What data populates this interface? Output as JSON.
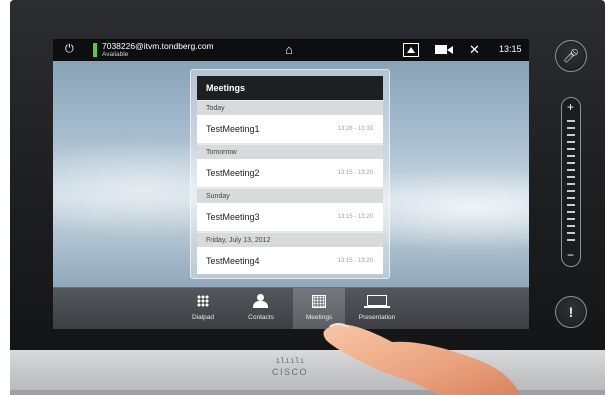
{
  "status_bar": {
    "user": "7038226@itvm.tondberg.com",
    "availability": "Available",
    "time": "13:15",
    "icons": [
      "power-icon",
      "home-icon",
      "selfview-icon",
      "camera-icon",
      "settings-tools-icon"
    ],
    "status_color": "#5fc83a"
  },
  "meetings_panel": {
    "title": "Meetings",
    "groups": [
      {
        "header": "Today",
        "meetings": [
          {
            "name": "TestMeeting1",
            "time": "13:28 - 13:33"
          }
        ]
      },
      {
        "header": "Tomorrow",
        "meetings": [
          {
            "name": "TestMeeting2",
            "time": "13:15 - 13:20"
          }
        ]
      },
      {
        "header": "Sunday",
        "meetings": [
          {
            "name": "TestMeeting3",
            "time": "13:15 - 13:20"
          }
        ]
      },
      {
        "header": "Friday, July 13, 2012",
        "meetings": [
          {
            "name": "TestMeeting4",
            "time": "13:15 - 13:20"
          }
        ]
      }
    ]
  },
  "bottom_nav": {
    "items": [
      {
        "label": "Dialpad",
        "icon": "dialpad-icon"
      },
      {
        "label": "Contacts",
        "icon": "contacts-icon"
      },
      {
        "label": "Meetings",
        "icon": "calendar-icon",
        "active": true
      },
      {
        "label": "Presentation",
        "icon": "laptop-icon"
      }
    ]
  },
  "side_controls": {
    "mute_icon": "microphone-mute-icon",
    "volume_plus": "+",
    "volume_minus": "−",
    "alert_symbol": "!"
  },
  "brand": {
    "bars": "ılıılı",
    "word": "CISCO"
  }
}
